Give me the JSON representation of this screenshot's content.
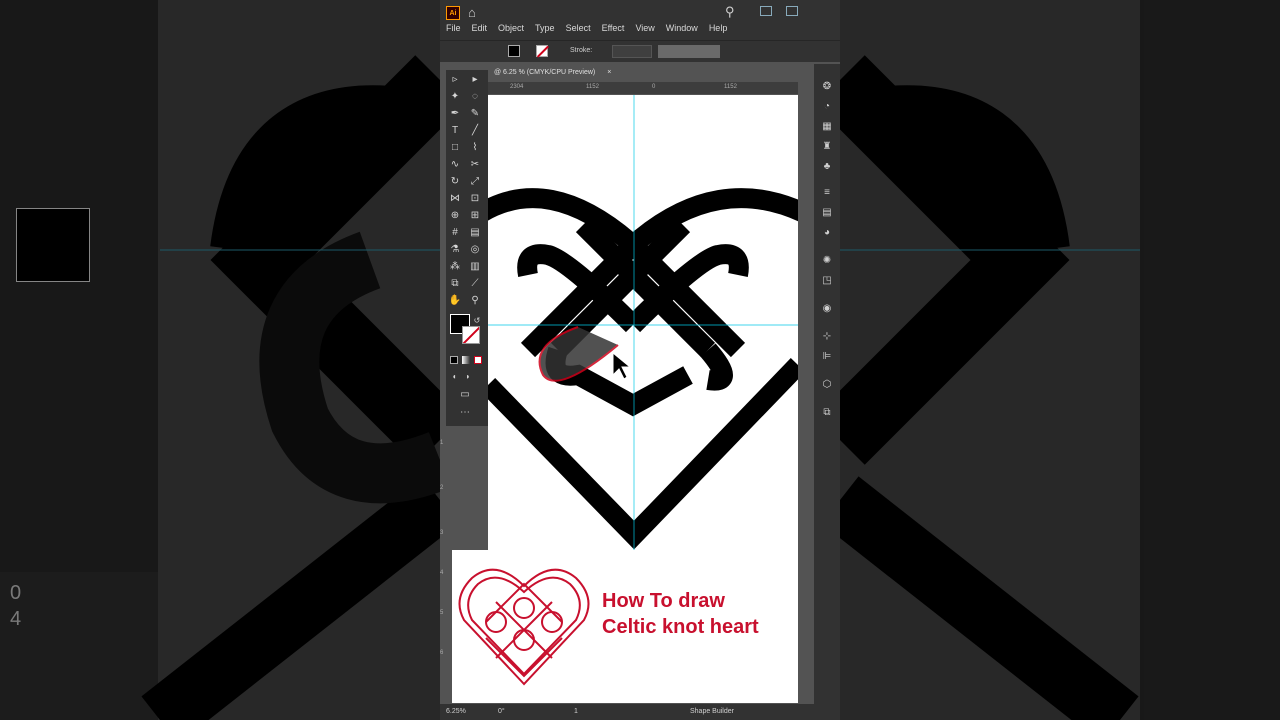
{
  "window": {
    "logo": "Ai",
    "doc_tab": "@ 6.25 % (CMYK/CPU Preview)",
    "close": "×"
  },
  "menus": [
    "File",
    "Edit",
    "Object",
    "Type",
    "Select",
    "Effect",
    "View",
    "Window",
    "Help"
  ],
  "control_bar": {
    "stroke_label": "Stroke:"
  },
  "ruler": {
    "ticks": [
      "2304",
      "1152",
      "0",
      "1152"
    ]
  },
  "tools": [
    "selection-icon",
    "direct-selection-icon",
    "magic-wand-icon",
    "lasso-icon",
    "pen-icon",
    "curvature-icon",
    "type-icon",
    "line-icon",
    "rectangle-icon",
    "paintbrush-icon",
    "shaper-icon",
    "scissors-icon",
    "rotate-icon",
    "scale-icon",
    "width-icon",
    "free-transform-icon",
    "shape-builder-icon",
    "perspective-icon",
    "mesh-icon",
    "gradient-icon",
    "eyedropper-icon",
    "blend-icon",
    "symbol-sprayer-icon",
    "column-graph-icon",
    "artboard-icon",
    "slice-icon",
    "hand-icon",
    "zoom-icon"
  ],
  "artwork": {
    "heading_line1": "How To draw",
    "heading_line2": "Celtic knot heart",
    "colors": {
      "accent": "#c8102e",
      "guide": "#00c8e6",
      "anchor": "#3c50c8"
    }
  },
  "status": {
    "zoom": "6.25%",
    "rotation": "0°",
    "artboard": "1",
    "tool": "Shape Builder"
  },
  "v_ruler": [
    "1",
    "2",
    "3",
    "4",
    "5",
    "6"
  ],
  "bg_text": [
    "0",
    "4"
  ]
}
